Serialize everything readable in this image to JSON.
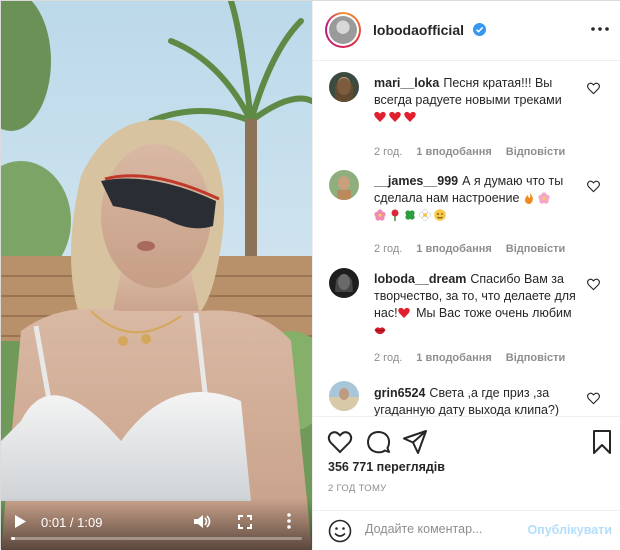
{
  "post": {
    "username": "lobodaofficial",
    "more_icon": "more-horizontal-icon",
    "verified_icon": "verified-badge-icon"
  },
  "video": {
    "time": "0:01 / 1:09",
    "progress": 0.0145,
    "play_icon": "play-icon",
    "volume_icon": "volume-icon",
    "fullscreen_icon": "fullscreen-icon",
    "more_icon": "more-vertical-icon"
  },
  "comments": [
    {
      "user": "mari__loka",
      "text": "Песня кратая!!! Вы всегда радуете новыми треками",
      "emojis": [
        "heart",
        "heart",
        "heart"
      ],
      "time": "2 год.",
      "likes": "1 вподобання",
      "reply": "Відповісти"
    },
    {
      "user": "__james__999",
      "text": "А я думаю что ты сделала нам настроение",
      "emojis": [
        "fire",
        "blossom",
        "blossom",
        "rose",
        "clover",
        "daisy",
        "wink"
      ],
      "time": "2 год.",
      "likes": "1 вподобання",
      "reply": "Відповісти"
    },
    {
      "user": "loboda__dream",
      "text_a": "Спасибо Вам за творчество, за то, что делаете для нас!",
      "text_b": "Мы Вас тоже очень любим",
      "time": "2 год.",
      "likes": "1 вподобання",
      "reply": "Відповісти"
    },
    {
      "user": "grin6524",
      "text": "Света ,а где приз ,за угаданную дату выхода клипа?)"
    }
  ],
  "actions": {
    "like_icon": "heart-icon",
    "comment_icon": "comment-icon",
    "share_icon": "share-icon",
    "save_icon": "bookmark-icon"
  },
  "stats": {
    "views": "356 771 переглядів",
    "posted": "2 ГОД ТОМУ"
  },
  "composer": {
    "emoji_icon": "smiley-icon",
    "placeholder": "Додайте коментар...",
    "publish_label": "Опублікувати"
  },
  "colors": {
    "link": "#0095f6",
    "publish_disabled": "#b2dffc",
    "muted": "#8e8e8e",
    "heart_red": "#ed4956"
  }
}
